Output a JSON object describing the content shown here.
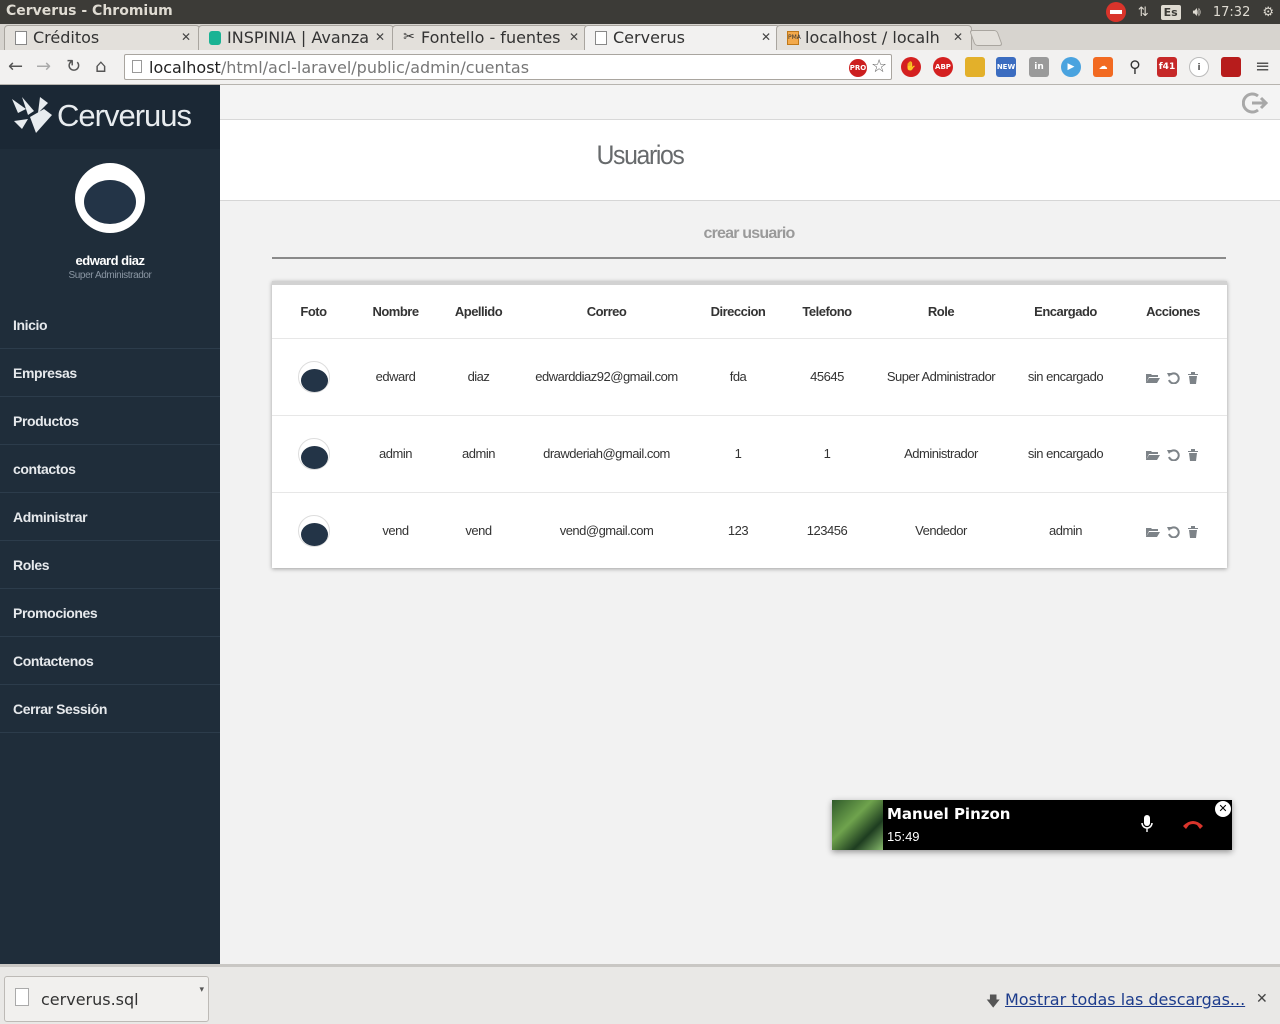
{
  "os": {
    "title": "Cerverus - Chromium",
    "lang": "Es",
    "time": "17:32"
  },
  "tabs": [
    {
      "label": "Créditos",
      "icon": "page-icon"
    },
    {
      "label": "INSPINIA | Avanza",
      "icon": "inspinia-icon"
    },
    {
      "label": "Fontello - fuentes",
      "icon": "scissors-icon"
    },
    {
      "label": "Cerverus",
      "icon": "page-icon",
      "active": true
    },
    {
      "label": "localhost / localh",
      "icon": "pma-icon"
    }
  ],
  "toolbar": {
    "url_host": "localhost",
    "url_path": "/html/acl-laravel/public/admin/cuentas",
    "ext_pro": "PRO",
    "ext_abp": "ABP",
    "ext_new": "NEW",
    "ext_f41": "f41"
  },
  "sidebar": {
    "brand": "Cerveruus",
    "user_name": "edward diaz",
    "user_role": "Super Administrador",
    "items": [
      {
        "label": "Inicio"
      },
      {
        "label": "Empresas"
      },
      {
        "label": "Productos"
      },
      {
        "label": "contactos"
      },
      {
        "label": "Administrar"
      },
      {
        "label": "Roles"
      },
      {
        "label": "Promociones"
      },
      {
        "label": "Contactenos"
      },
      {
        "label": "Cerrar Sessión"
      }
    ]
  },
  "main": {
    "title": "Usuarios",
    "create_link": "crear usuario",
    "table": {
      "columns": [
        "Foto",
        "Nombre",
        "Apellido",
        "Correo",
        "Direccion",
        "Telefono",
        "Role",
        "Encargado",
        "Acciones"
      ],
      "rows": [
        {
          "nombre": "edward",
          "apellido": "diaz",
          "correo": "edwarddiaz92@gmail.com",
          "direccion": "fda",
          "telefono": "45645",
          "role": "Super Administrador",
          "encargado": "sin encargado"
        },
        {
          "nombre": "admin",
          "apellido": "admin",
          "correo": "drawderiah@gmail.com",
          "direccion": "1",
          "telefono": "1",
          "role": "Administrador",
          "encargado": "sin encargado"
        },
        {
          "nombre": "vend",
          "apellido": "vend",
          "correo": "vend@gmail.com",
          "direccion": "123",
          "telefono": "123456",
          "role": "Vendedor",
          "encargado": "admin"
        }
      ]
    }
  },
  "call": {
    "name": "Manuel Pinzon",
    "time": "15:49"
  },
  "downloads": {
    "file": "cerverus.sql",
    "show_all": "Mostrar todas las descargas..."
  },
  "colors": {
    "sidebar_bg": "#1f2d3a",
    "hangup_red": "#d9342b",
    "link_blue": "#1d3c8c"
  }
}
